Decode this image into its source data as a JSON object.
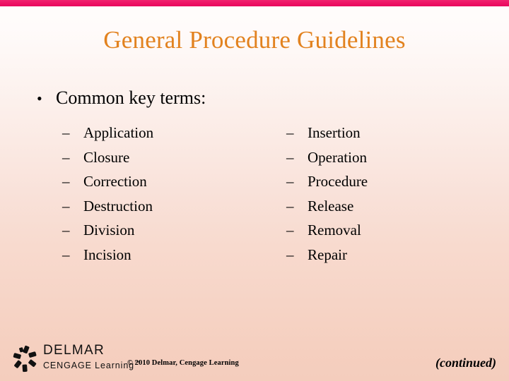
{
  "slide": {
    "title": "General Procedure Guidelines",
    "accent_bar_color": "#ed1164",
    "title_color": "#e2821f",
    "background_top_color": "#fffdfc",
    "background_bottom_color": "#f4cdbd"
  },
  "body": {
    "heading": "Common key terms:",
    "bullet_glyph": "•",
    "dash_glyph": "–",
    "columns": [
      {
        "name": "left",
        "items": [
          "Application",
          "Closure",
          "Correction",
          "Destruction",
          "Division",
          "Incision"
        ]
      },
      {
        "name": "right",
        "items": [
          "Insertion",
          "Operation",
          "Procedure",
          "Release",
          "Removal",
          "Repair"
        ]
      }
    ]
  },
  "footer": {
    "logo_primary": "DELMAR",
    "logo_secondary": "CENGAGE Learning",
    "logo_trademark": "™",
    "copyright": "© 2010 Delmar, Cengage Learning",
    "continued": "(continued)"
  }
}
